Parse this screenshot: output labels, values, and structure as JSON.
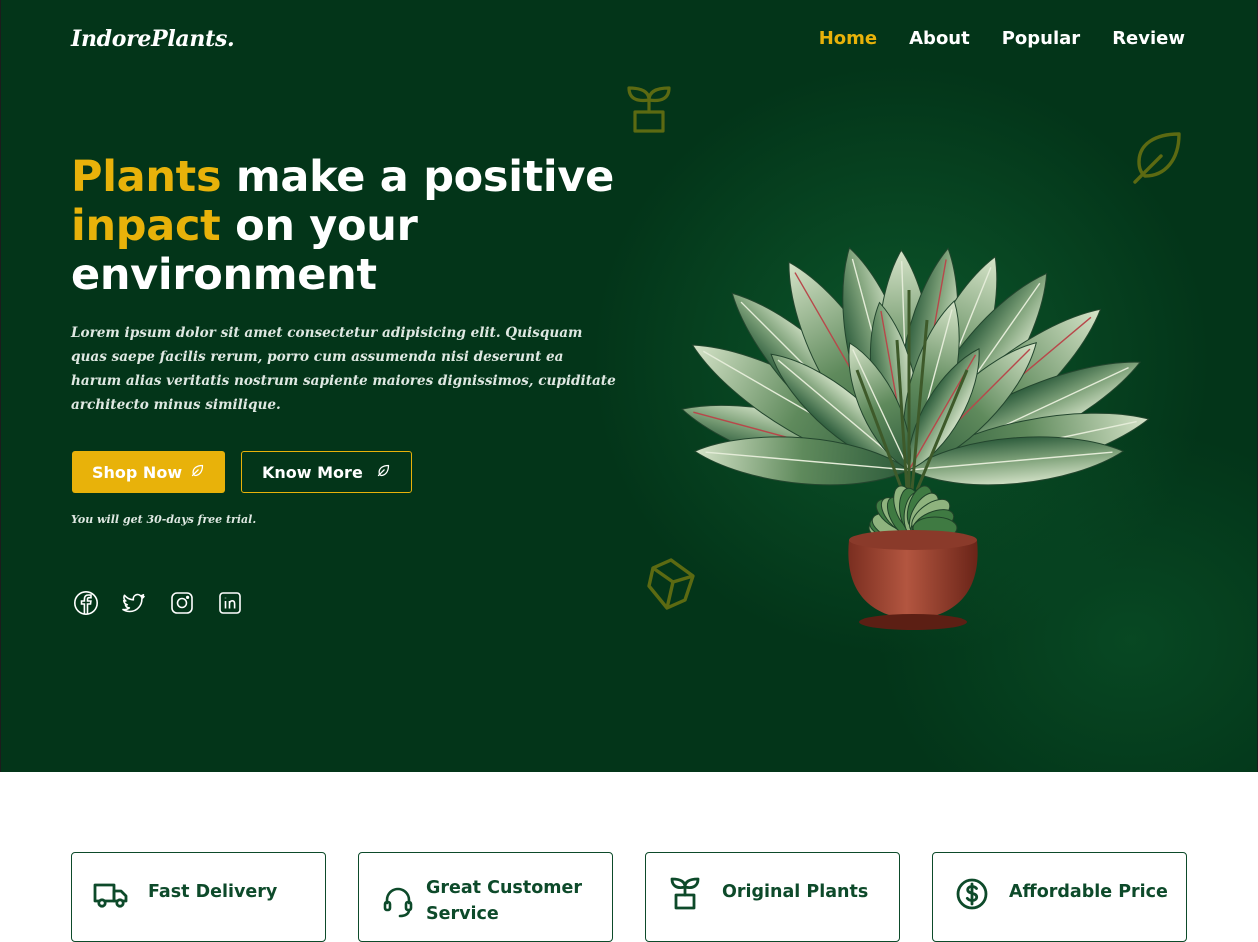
{
  "brand": {
    "logo": "IndorePlants."
  },
  "nav": {
    "items": [
      "Home",
      "About",
      "Popular",
      "Review"
    ],
    "active": "Home"
  },
  "hero": {
    "headline": {
      "part1": "Plants",
      "part2": " make a positive ",
      "part3": "inpact",
      "part4": " on your environment"
    },
    "description": "Lorem ipsum dolor sit amet consectetur adipisicing elit. Quisquam quas saepe facilis rerum, porro cum assumenda nisi deserunt ea harum alias veritatis nostrum sapiente maiores dignissimos, cupiditate architecto minus similique.",
    "shop_button": "Shop Now",
    "know_button": "Know More",
    "trial_note": "You will get 30-days free trial."
  },
  "social": [
    "facebook-icon",
    "twitter-icon",
    "instagram-icon",
    "linkedin-icon"
  ],
  "features": [
    {
      "label": "Fast Delivery",
      "icon": "truck-icon"
    },
    {
      "label": "Great Customer Service",
      "icon": "headset-icon"
    },
    {
      "label": "Original Plants",
      "icon": "sprout-icon"
    },
    {
      "label": "Affordable Price",
      "icon": "dollar-icon"
    }
  ],
  "colors": {
    "accent": "#e8b20a",
    "background": "#033519",
    "card_text": "#0d4a2a"
  }
}
